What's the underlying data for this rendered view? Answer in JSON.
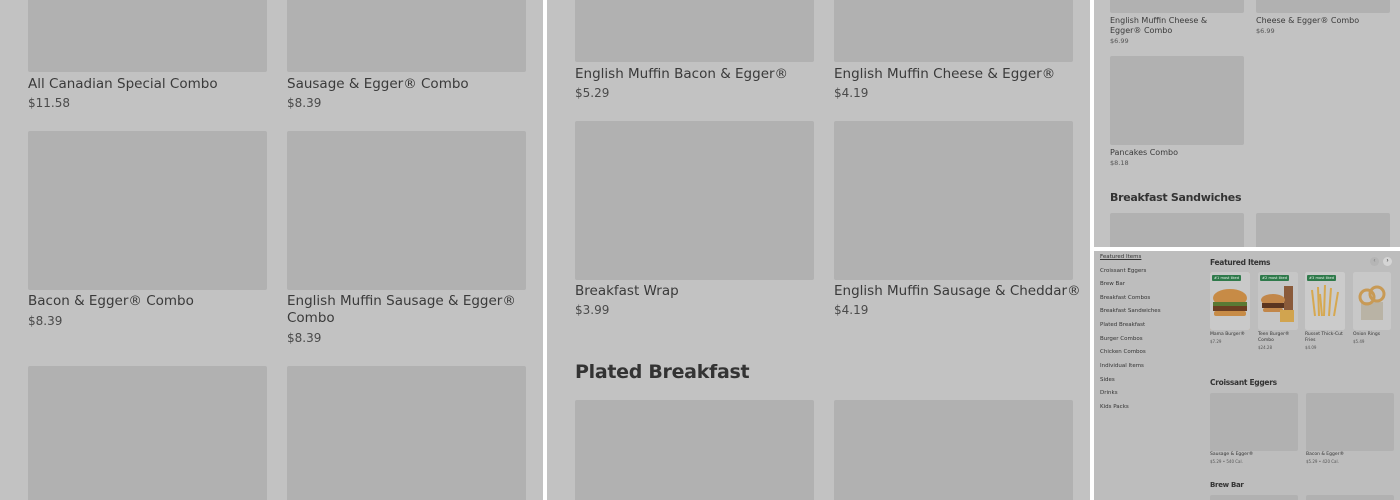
{
  "panel1": {
    "items": [
      {
        "name": "All Canadian Special Combo",
        "price": "$11.58"
      },
      {
        "name": "Sausage & Egger® Combo",
        "price": "$8.39"
      },
      {
        "name": "Bacon & Egger® Combo",
        "price": "$8.39"
      },
      {
        "name": "English Muffin Sausage & Egger® Combo",
        "price": "$8.39"
      }
    ]
  },
  "panel2": {
    "items": [
      {
        "name": "English Muffin Bacon & Egger®",
        "price": "$5.29"
      },
      {
        "name": "English Muffin Cheese & Egger®",
        "price": "$4.19"
      },
      {
        "name": "Breakfast Wrap",
        "price": "$3.99"
      },
      {
        "name": "English Muffin Sausage & Cheddar®",
        "price": "$4.19"
      }
    ],
    "section_title": "Plated Breakfast"
  },
  "panel3": {
    "items": [
      {
        "name": "English Muffin Cheese & Egger® Combo",
        "price": "$6.99"
      },
      {
        "name": "Cheese & Egger® Combo",
        "price": "$6.99"
      },
      {
        "name": "Pancakes Combo",
        "price": "$8.18"
      }
    ],
    "section_title": "Breakfast Sandwiches"
  },
  "panel4": {
    "nav": [
      "Featured Items",
      "Croissant Eggers",
      "Brew Bar",
      "Breakfast Combos",
      "Breakfast Sandwiches",
      "Plated Breakfast",
      "Burger Combos",
      "Chicken Combos",
      "Individual Items",
      "Sides",
      "Drinks",
      "Kids Packs"
    ],
    "featured_title": "Featured Items",
    "prev_label": "‹",
    "next_label": "›",
    "featured": [
      {
        "badge": "#1 most liked",
        "name": "Mama Burger®",
        "price": "$7.29",
        "color": "#b98a55"
      },
      {
        "badge": "#2 most liked",
        "name": "Teen Burger® Combo",
        "price": "$24.28",
        "color": "#a0775a"
      },
      {
        "badge": "#3 most liked",
        "name": "Russet Thick-Cut Fries",
        "price": "$4.09",
        "color": "#c19a57"
      },
      {
        "badge": "",
        "name": "Onion Rings",
        "price": "$5.49",
        "color": "#b6a07c"
      }
    ],
    "croissant_title": "Croissant Eggers",
    "croissant_items": [
      {
        "name": "Sausage & Egger®",
        "price": "$5.29 • 540 Cal."
      },
      {
        "name": "Bacon & Egger®",
        "price": "$5.29 • 420 Cal."
      }
    ],
    "brew_title": "Brew Bar"
  }
}
